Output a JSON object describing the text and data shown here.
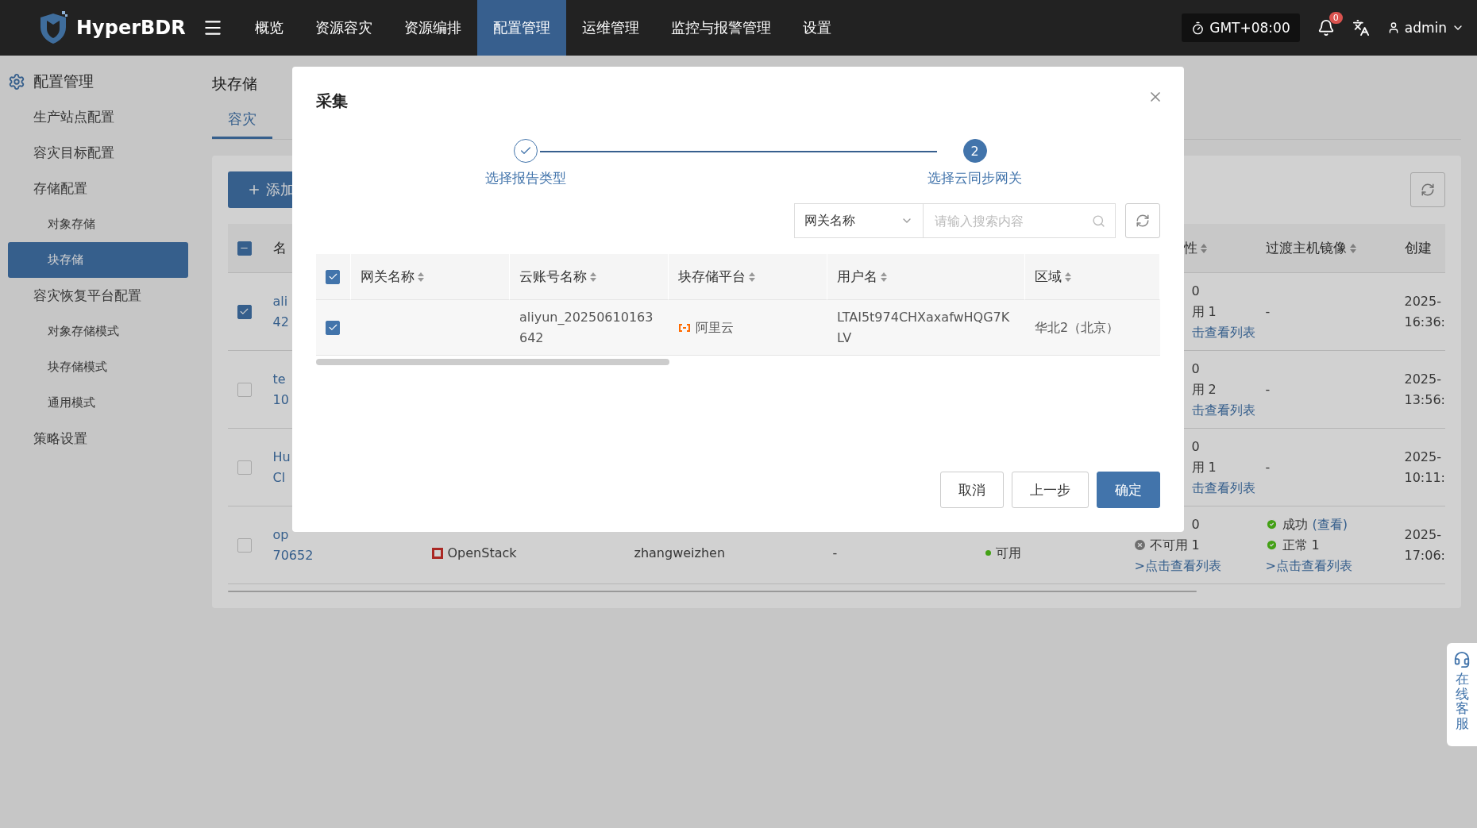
{
  "topbar": {
    "brand": "HyperBDR",
    "nav": [
      {
        "label": "概览",
        "selected": false
      },
      {
        "label": "资源容灾",
        "selected": false
      },
      {
        "label": "资源编排",
        "selected": false
      },
      {
        "label": "配置管理",
        "selected": true
      },
      {
        "label": "运维管理",
        "selected": false
      },
      {
        "label": "监控与报警管理",
        "selected": false
      },
      {
        "label": "设置",
        "selected": false
      }
    ],
    "timezone": "GMT+08:00",
    "alerts_badge": "0",
    "user": "admin"
  },
  "sidebar": {
    "title": "配置管理",
    "items": [
      {
        "label": "生产站点配置",
        "selected": false
      },
      {
        "label": "容灾目标配置",
        "selected": false
      },
      {
        "label": "存储配置",
        "selected": false,
        "children": [
          {
            "label": "对象存储",
            "selected": false
          },
          {
            "label": "块存储",
            "selected": true
          }
        ]
      },
      {
        "label": "容灾恢复平台配置",
        "selected": false,
        "children": [
          {
            "label": "对象存储模式",
            "selected": false
          },
          {
            "label": "块存储模式",
            "selected": false
          },
          {
            "label": "通用模式",
            "selected": false
          }
        ]
      },
      {
        "label": "策略设置",
        "selected": false
      }
    ]
  },
  "page": {
    "title": "块存储",
    "tabs": [
      {
        "label": "容灾",
        "selected": true
      }
    ],
    "add_button": "添加",
    "table": {
      "header_checked": true,
      "header_partial": true,
      "columns": {
        "name": "名",
        "availability": "性",
        "transit": "过渡主机镜像",
        "created": "创建"
      },
      "rows": [
        {
          "checked": true,
          "name": [
            "ali",
            "42"
          ],
          "availability": [
            {
              "kind": "partial",
              "text": "0"
            },
            {
              "kind": "partial",
              "text": "用 1"
            },
            {
              "kind": "partial_link",
              "text": "击查看列表"
            }
          ],
          "transit": [
            {
              "kind": "text",
              "text": "-"
            }
          ],
          "created": [
            "2025-",
            "16:36:"
          ]
        },
        {
          "checked": false,
          "name": [
            "te",
            "10"
          ],
          "availability": [
            {
              "kind": "partial",
              "text": "0"
            },
            {
              "kind": "partial",
              "text": "用 2"
            },
            {
              "kind": "partial_link",
              "text": "击查看列表"
            }
          ],
          "transit": [
            {
              "kind": "text",
              "text": "-"
            }
          ],
          "created": [
            "2025-",
            "13:56:"
          ]
        },
        {
          "checked": false,
          "name": [
            "Hu",
            "Cl"
          ],
          "availability": [
            {
              "kind": "partial",
              "text": "0"
            },
            {
              "kind": "partial",
              "text": "用 1"
            },
            {
              "kind": "partial_link",
              "text": "击查看列表"
            }
          ],
          "transit": [
            {
              "kind": "text",
              "text": "-"
            }
          ],
          "created": [
            "2025-",
            "10:11:"
          ]
        },
        {
          "checked": false,
          "name": [
            "op",
            "70652"
          ],
          "platform": "OpenStack",
          "user": "zhangweizhen",
          "column_5": "-",
          "status": {
            "text": "可用",
            "color": "#43a115"
          },
          "availability": [
            {
              "kind": "partial",
              "text": "0"
            },
            {
              "kind": "fail",
              "text": "不可用 1"
            },
            {
              "kind": "link",
              "text": ">点击查看列表"
            }
          ],
          "transit": [
            {
              "kind": "ok",
              "text": "成功",
              "link": "(查看)"
            },
            {
              "kind": "ok",
              "text": "正常 1"
            },
            {
              "kind": "link",
              "text": ">点击查看列表"
            }
          ],
          "created": [
            "2025-",
            "17:06:"
          ]
        }
      ]
    }
  },
  "dialog": {
    "title": "采集",
    "steps": [
      {
        "label": "选择报告类型",
        "completed": true,
        "active": false
      },
      {
        "label": "选择云同步网关",
        "completed": false,
        "active": true,
        "number": "2"
      }
    ],
    "filter": {
      "field": "网关名称",
      "placeholder": "请输入搜索内容"
    },
    "table": {
      "all_checked": true,
      "columns": [
        "网关名称",
        "云账号名称",
        "块存储平台",
        "用户名",
        "区域"
      ],
      "rows": [
        {
          "checked": true,
          "account": "aliyun_20250610163642",
          "platform": "阿里云",
          "username": "LTAI5t974CHXaxafwHQG7KLV",
          "region": "华北2（北京）"
        }
      ]
    },
    "buttons": [
      {
        "label": "取消",
        "kind": "default"
      },
      {
        "label": "上一步",
        "kind": "default"
      },
      {
        "label": "确定",
        "kind": "primary"
      }
    ]
  },
  "service": {
    "label": "在线客服"
  }
}
